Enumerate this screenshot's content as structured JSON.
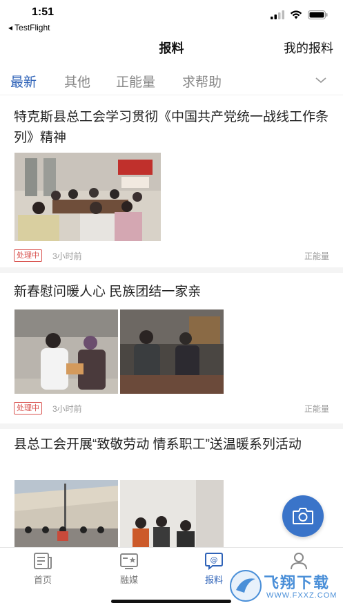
{
  "status_bar": {
    "time": "1:51",
    "back_app": "◂ TestFlight"
  },
  "header": {
    "title": "报料",
    "right_link": "我的报料"
  },
  "tabs": [
    {
      "label": "最新",
      "active": true
    },
    {
      "label": "其他",
      "active": false
    },
    {
      "label": "正能量",
      "active": false
    },
    {
      "label": "求帮助",
      "active": false
    }
  ],
  "posts": [
    {
      "title": "特克斯县总工会学习贯彻《中国共产党统一战线工作条列》精神",
      "status": "处理中",
      "time": "3小时前",
      "category": "正能量",
      "images": [
        "meeting-room-photo"
      ]
    },
    {
      "title": "新春慰问暖人心 民族团结一家亲",
      "status": "处理中",
      "time": "3小时前",
      "category": "正能量",
      "images": [
        "visit-gift-photo",
        "elderly-visit-photo"
      ]
    },
    {
      "title": "县总工会开展“致敬劳动 情系职工”送温暖系列活动",
      "images": [
        "outdoor-group-photo",
        "indoor-visit-photo"
      ]
    }
  ],
  "bottom_nav": [
    {
      "label": "首页",
      "icon": "home-news-icon",
      "active": false
    },
    {
      "label": "融媒",
      "icon": "media-icon",
      "active": false
    },
    {
      "label": "报料",
      "icon": "report-icon",
      "active": true
    },
    {
      "label": "",
      "icon": "profile-icon",
      "active": false
    }
  ],
  "watermark": {
    "text": "飞翔下载",
    "sub": "WWW.FXXZ.COM"
  },
  "colors": {
    "accent": "#2f63b8",
    "badge": "#d9534f",
    "fab": "#3a74c9"
  }
}
